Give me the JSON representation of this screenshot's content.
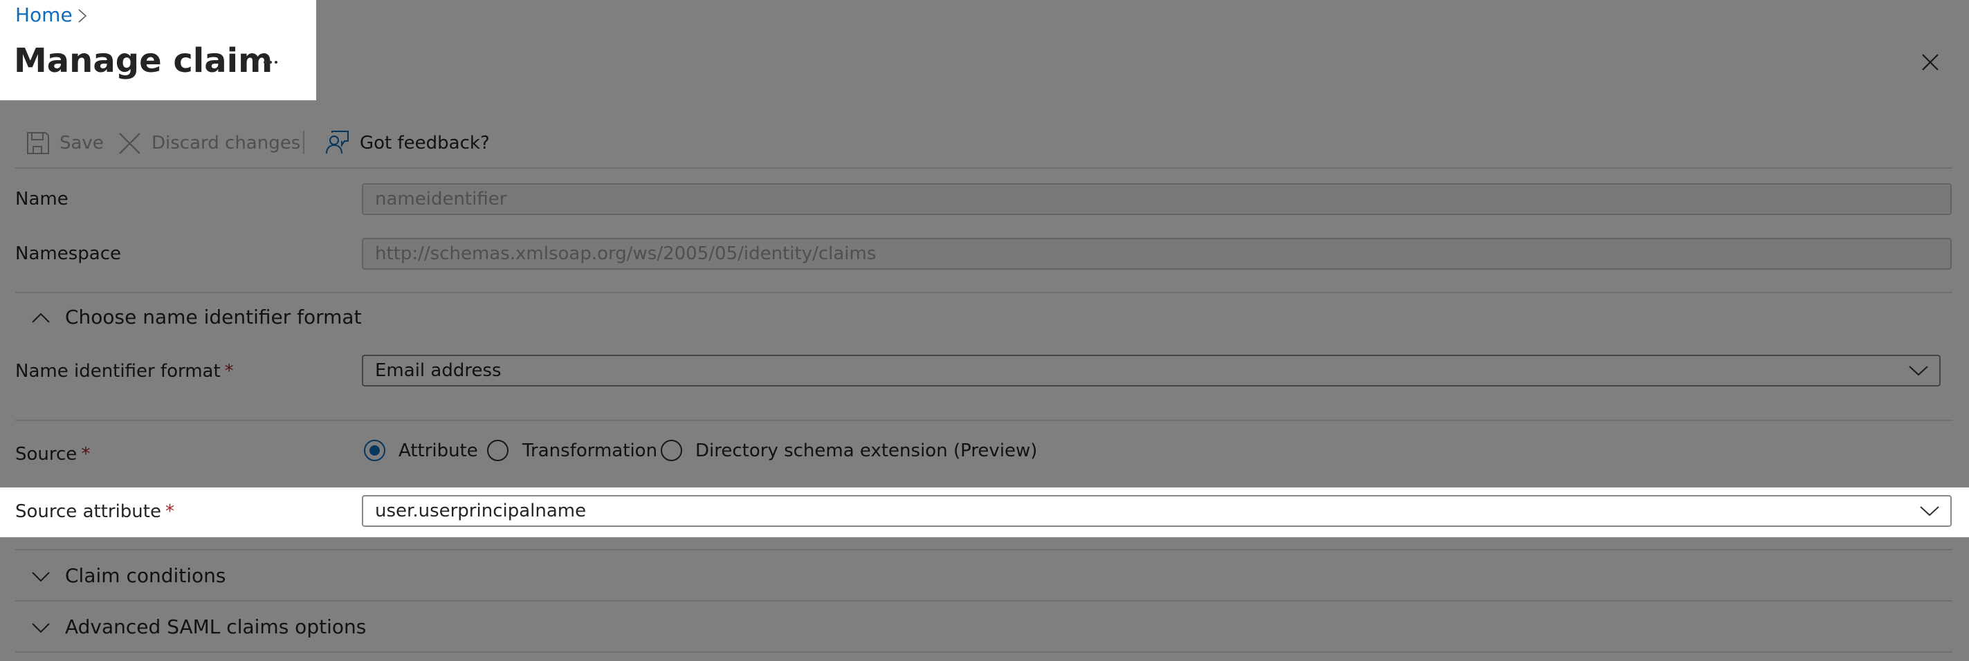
{
  "breadcrumb": {
    "home": "Home",
    "separator": "›"
  },
  "header": {
    "title": "Manage claim",
    "more_label": "···",
    "close_label": "Close"
  },
  "toolbar": {
    "save_label": "Save",
    "discard_label": "Discard changes",
    "feedback_label": "Got feedback?"
  },
  "form": {
    "name": {
      "label": "Name",
      "value": "nameidentifier"
    },
    "namespace": {
      "label": "Namespace",
      "value": "http://schemas.xmlsoap.org/ws/2005/05/identity/claims"
    },
    "name_id_section": {
      "title": "Choose name identifier format",
      "expanded": true
    },
    "name_id_format": {
      "label": "Name identifier format",
      "required": "*",
      "value": "Email address"
    },
    "source": {
      "label": "Source",
      "required": "*",
      "options": [
        {
          "label": "Attribute",
          "checked": true
        },
        {
          "label": "Transformation",
          "checked": false
        },
        {
          "label": "Directory schema extension (Preview)",
          "checked": false
        }
      ]
    },
    "source_attribute": {
      "label": "Source attribute",
      "required": "*",
      "value": "user.userprincipalname"
    }
  },
  "sections": {
    "claim_conditions": {
      "title": "Claim conditions",
      "expanded": false
    },
    "advanced_saml": {
      "title": "Advanced SAML claims options",
      "expanded": false
    }
  },
  "colors": {
    "link": "#0f6cbd",
    "required": "#a4262c",
    "overlay": "rgba(0,0,0,0.5)"
  }
}
